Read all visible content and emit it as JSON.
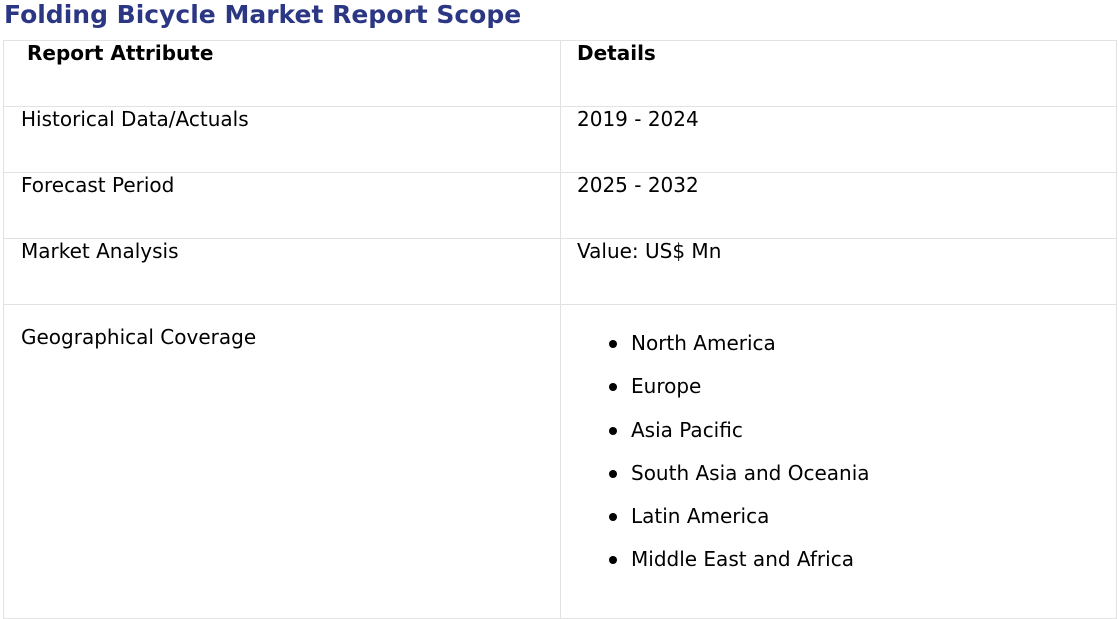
{
  "title": "Folding Bicycle Market Report Scope",
  "table": {
    "headers": [
      "Report Attribute",
      "Details"
    ],
    "rows": [
      {
        "attribute": "Historical Data/Actuals",
        "details": "2019 - 2024"
      },
      {
        "attribute": "Forecast Period",
        "details": "2025 - 2032"
      },
      {
        "attribute": "Market Analysis",
        "details": "Value: US$ Mn"
      }
    ],
    "geo": {
      "attribute": "Geographical Coverage",
      "regions": [
        "North America",
        "Europe",
        "Asia Pacific",
        "South Asia and Oceania",
        "Latin America",
        "Middle East and Africa"
      ]
    }
  },
  "colors": {
    "title": "#2c3784",
    "border": "#e2e2e2"
  }
}
